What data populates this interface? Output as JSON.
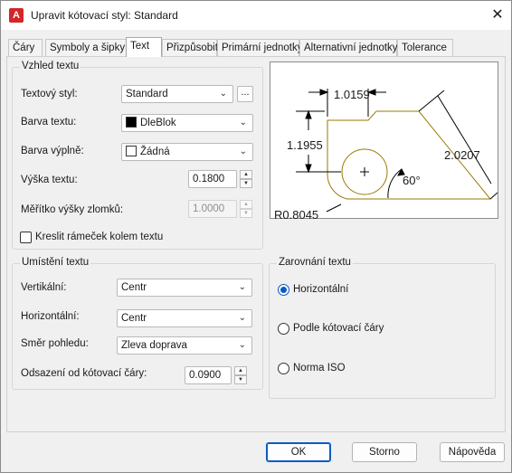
{
  "window": {
    "title": "Upravit kótovací styl: Standard",
    "app_icon_letter": "A",
    "close_glyph": "✕"
  },
  "tabs": [
    {
      "label": "Čáry"
    },
    {
      "label": "Symboly a šipky"
    },
    {
      "label": "Text",
      "active": true
    },
    {
      "label": "Přizpůsobit"
    },
    {
      "label": "Primární jednotky"
    },
    {
      "label": "Alternativní jednotky"
    },
    {
      "label": "Tolerance"
    }
  ],
  "text_appearance": {
    "group_title": "Vzhled textu",
    "style_label": "Textový styl:",
    "style_value": "Standard",
    "style_browse": "...",
    "color_label": "Barva textu:",
    "color_value": "DleBlok",
    "color_swatch": "#000000",
    "fill_label": "Barva výplně:",
    "fill_value": "Žádná",
    "fill_swatch": "#ffffff",
    "height_label": "Výška textu:",
    "height_value": "0.1800",
    "fraction_label": "Měřítko výšky zlomků:",
    "fraction_value": "1.0000",
    "frame_label": "Kreslit rámeček kolem textu",
    "frame_checked": false
  },
  "preview": {
    "dim_top": "1.0159",
    "dim_left": "1.1955",
    "dim_right": "2.0207",
    "angle": "60°",
    "radius": "R0.8045",
    "line_color": "#9a7a00"
  },
  "placement": {
    "group_title": "Umístění textu",
    "vertical_label": "Vertikální:",
    "vertical_value": "Centr",
    "horizontal_label": "Horizontální:",
    "horizontal_value": "Centr",
    "direction_label": "Směr pohledu:",
    "direction_value": "Zleva doprava",
    "offset_label": "Odsazení od kótovací čáry:",
    "offset_value": "0.0900"
  },
  "alignment": {
    "group_title": "Zarovnání textu",
    "options": [
      {
        "label": "Horizontální",
        "selected": true
      },
      {
        "label": "Podle kótovací čáry",
        "selected": false
      },
      {
        "label": "Norma ISO",
        "selected": false
      }
    ]
  },
  "buttons": {
    "ok": "OK",
    "cancel": "Storno",
    "help": "Nápověda"
  },
  "icons": {
    "chevron": "chevron-down-icon",
    "spin_up": "triangle-up-icon",
    "spin_down": "triangle-down-icon"
  }
}
